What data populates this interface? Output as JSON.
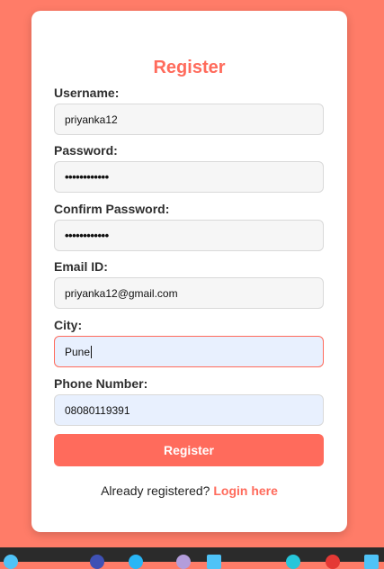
{
  "form": {
    "title": "Register",
    "fields": [
      {
        "label": "Username:",
        "value": "priyanka12"
      },
      {
        "label": "Password:",
        "value": "••••••••••••"
      },
      {
        "label": "Confirm Password:",
        "value": "••••••••••••"
      },
      {
        "label": "Email ID:",
        "value": "priyanka12@gmail.com"
      },
      {
        "label": "City:",
        "value": "Pune"
      },
      {
        "label": "Phone Number:",
        "value": "08080119391"
      }
    ],
    "submit_label": "Register",
    "footer_text": "Already registered? ",
    "footer_link": "Login here"
  },
  "colors": {
    "background": "#ff7c68",
    "accent": "#ff6b5c",
    "card": "#ffffff"
  }
}
